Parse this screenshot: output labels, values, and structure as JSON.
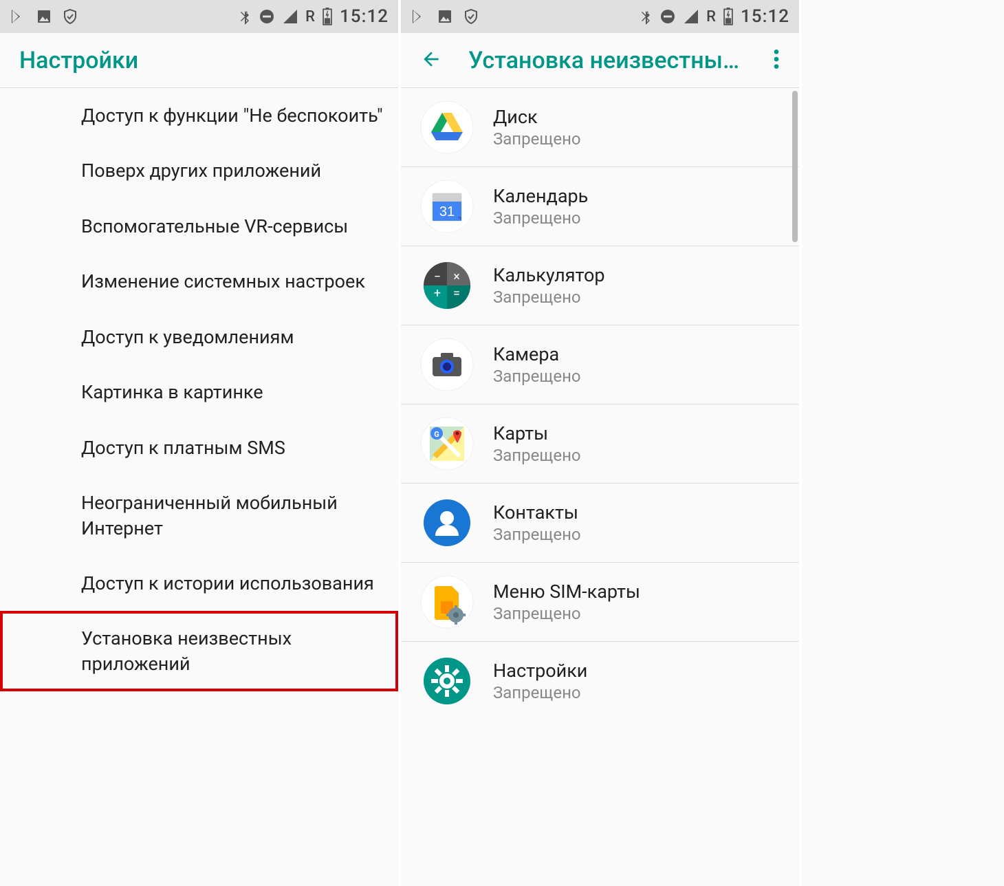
{
  "status": {
    "network_label": "R",
    "time": "15:12"
  },
  "left": {
    "title": "Настройки",
    "items": [
      {
        "label": "Доступ к функции \"Не беспокоить\""
      },
      {
        "label": "Поверх других приложений"
      },
      {
        "label": "Вспомогательные VR-сервисы"
      },
      {
        "label": "Изменение системных настроек"
      },
      {
        "label": "Доступ к уведомлениям"
      },
      {
        "label": "Картинка в картинке"
      },
      {
        "label": "Доступ к платным SMS"
      },
      {
        "label": "Неограниченный мобильный Интернет"
      },
      {
        "label": "Доступ к истории использования"
      },
      {
        "label": "Установка неизвестных приложений",
        "highlighted": true
      }
    ]
  },
  "right": {
    "title": "Установка неизвестны…",
    "apps": [
      {
        "name": "Диск",
        "status": "Запрещено",
        "icon": "drive"
      },
      {
        "name": "Календарь",
        "status": "Запрещено",
        "icon": "calendar",
        "icon_text": "31"
      },
      {
        "name": "Калькулятор",
        "status": "Запрещено",
        "icon": "calculator"
      },
      {
        "name": "Камера",
        "status": "Запрещено",
        "icon": "camera"
      },
      {
        "name": "Карты",
        "status": "Запрещено",
        "icon": "maps"
      },
      {
        "name": "Контакты",
        "status": "Запрещено",
        "icon": "contacts"
      },
      {
        "name": "Меню SIM-карты",
        "status": "Запрещено",
        "icon": "sim"
      },
      {
        "name": "Настройки",
        "status": "Запрещено",
        "icon": "settings"
      }
    ]
  }
}
